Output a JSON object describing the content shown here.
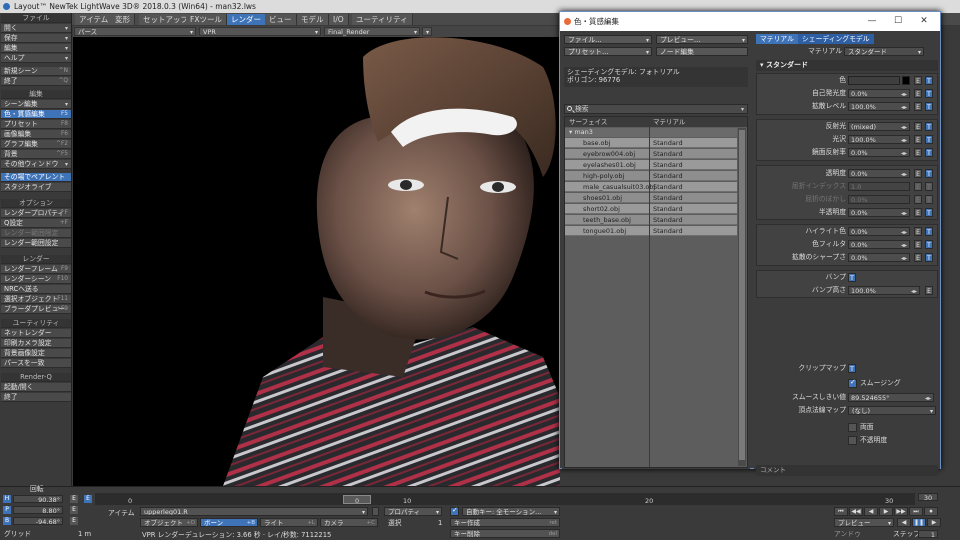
{
  "window": {
    "title": "Layout™ NewTek LightWave 3D® 2018.0.3 (Win64) - man32.lws"
  },
  "menu_tabs": [
    "アイテム",
    "変形",
    "セットアップ",
    "FXツール",
    "レンダー",
    "ビュー",
    "モデル",
    "I/O",
    "ユーティリティ"
  ],
  "active_tab": "レンダー",
  "sidebar": {
    "file_header": "ファイル",
    "file_items": [
      {
        "label": "開く",
        "dropdown": true
      },
      {
        "label": "保存",
        "dropdown": true
      },
      {
        "label": "編集",
        "dropdown": true
      },
      {
        "label": "ヘルプ",
        "dropdown": true
      }
    ],
    "new_scene": {
      "label": "新規シーン",
      "shortcut": "^N"
    },
    "quit": {
      "label": "終了",
      "shortcut": "^Q"
    },
    "edit_header": "編集",
    "edit_items": [
      {
        "label": "シーン編集",
        "shortcut": "",
        "dropdown": true
      },
      {
        "label": "色・質感編集",
        "shortcut": "F5",
        "active": true
      },
      {
        "label": "プリセット",
        "shortcut": "F8"
      },
      {
        "label": "画像編集",
        "shortcut": "F6"
      },
      {
        "label": "グラフ編集",
        "shortcut": "^F2"
      },
      {
        "label": "背景",
        "shortcut": "^F5"
      },
      {
        "label": "その他ウィンドウ",
        "dropdown": true
      },
      {
        "label": "その場でペアレント",
        "active": true
      },
      {
        "label": "スタジオライブ"
      }
    ],
    "option_header": "オプション",
    "option_items": [
      {
        "label": "レンダープロパティ",
        "shortcut": "^F"
      },
      {
        "label": "Q設定",
        "shortcut": "+F"
      },
      {
        "label": "レンダー範囲限定",
        "disabled": true
      },
      {
        "label": "レンダー範囲設定"
      }
    ],
    "render_header": "レンダー",
    "render_items": [
      {
        "label": "レンダーフレーム",
        "shortcut": "F9"
      },
      {
        "label": "レンダーシーン",
        "shortcut": "F10"
      },
      {
        "label": "NRCへ送る"
      },
      {
        "label": "選択オブジェクト",
        "shortcut": "F11"
      },
      {
        "label": "ブラーダプレビュー",
        "shortcut": "+F9"
      }
    ],
    "utility_header": "ユーティリティ",
    "utility_items": [
      {
        "label": "ネットレンダー"
      },
      {
        "label": "印刷カメラ設定"
      },
      {
        "label": "背景画像設定"
      },
      {
        "label": "パースを一致"
      }
    ],
    "renderq_header": "Render-Q",
    "renderq_items": [
      {
        "label": "起動/開く"
      },
      {
        "label": "終了"
      }
    ]
  },
  "viewport": {
    "view_mode": "パース",
    "render_mode": "VPR",
    "camera": "Final_Render"
  },
  "dialog": {
    "title": "色・質感編集",
    "buttons": {
      "file": "ファイル...",
      "preview": "プレビュー...",
      "preset": "プリセット...",
      "node_edit": "ノード編集"
    },
    "shading_model_line": "シェーディングモデル: フォトリアル",
    "polygon_line": "ポリゴン: 96776",
    "search_placeholder": "検索",
    "columns": {
      "surface": "サーフェイス",
      "material": "マテリアル"
    },
    "group": "man3",
    "surfaces": [
      {
        "name": "base.obj",
        "material": "Standard"
      },
      {
        "name": "eyebrow004.obj",
        "material": "Standard"
      },
      {
        "name": "eyelashes01.obj",
        "material": "Standard"
      },
      {
        "name": "high-poly.obj",
        "material": "Standard"
      },
      {
        "name": "male_casualsuit03.obj",
        "material": "Standard"
      },
      {
        "name": "shoes01.obj",
        "material": "Standard"
      },
      {
        "name": "short02.obj",
        "material": "Standard"
      },
      {
        "name": "teeth_base.obj",
        "material": "Standard"
      },
      {
        "name": "tongue01.obj",
        "material": "Standard"
      }
    ],
    "right_tabs": [
      "マテリアル",
      "シェーディングモデル"
    ],
    "material_label": "マテリアル",
    "material_value": "スタンダード",
    "section_standard": "スタンダード",
    "props": {
      "color": "色",
      "luminosity": {
        "label": "自己発光度",
        "value": "0.0%"
      },
      "diffuse": {
        "label": "拡散レベル",
        "value": "100.0%"
      },
      "reflection": {
        "label": "反射光",
        "value": "(mixed)"
      },
      "gloss": {
        "label": "光沢",
        "value": "100.0%"
      },
      "specular": {
        "label": "鏡面反射率",
        "value": "0.0%"
      },
      "transparency": {
        "label": "透明度",
        "value": "0.0%"
      },
      "refraction": {
        "label": "屈折インデックス",
        "value": "1.0"
      },
      "refraction_blur": {
        "label": "屈折のぼかし",
        "value": "0.0%"
      },
      "translucency": {
        "label": "半透明度",
        "value": "0.0%"
      },
      "highlight": {
        "label": "ハイライト色",
        "value": "0.0%"
      },
      "color_filter": {
        "label": "色フィルタ",
        "value": "0.0%"
      },
      "diffuse_sharpness": {
        "label": "拡散のシャープさ",
        "value": "0.0%"
      },
      "bump": {
        "label": "バンプ"
      },
      "bump_height": {
        "label": "バンプ高さ",
        "value": "100.0%"
      },
      "clip_map": {
        "label": "クリップマップ"
      },
      "smoothing": {
        "label": "スムージング",
        "checked": true
      },
      "smooth_threshold": {
        "label": "スムースしきい値",
        "value": "89.524655°"
      },
      "vertex_normal": {
        "label": "頂点法線マップ",
        "value": "(なし)"
      },
      "double_sided": {
        "label": "両面",
        "checked": false
      },
      "opaque": {
        "label": "不透明度",
        "checked": false
      }
    },
    "comment_label": "コメント"
  },
  "timeline": {
    "rotation_label": "回転",
    "h": {
      "label": "H",
      "value": "90.38°"
    },
    "p": {
      "label": "P",
      "value": "8.80°"
    },
    "b": {
      "label": "B",
      "value": "-94.68°"
    },
    "grid": {
      "label": "グリッド",
      "value": "1 m"
    },
    "ruler_ticks": [
      "0",
      "10",
      "20",
      "30"
    ],
    "current_frame": "0",
    "end_frame": "30",
    "item_label": "アイテム",
    "item_value": "upperleg01.R",
    "objects_btn": {
      "label": "オブジェクト",
      "shortcut": "+O"
    },
    "bones_btn": {
      "label": "ボーン",
      "shortcut": "+B"
    },
    "lights_btn": {
      "label": "ライト",
      "shortcut": "+L"
    },
    "cameras_btn": {
      "label": "カメラ",
      "shortcut": "+C"
    },
    "properties_btn": "プロパティ",
    "select_label": "選択",
    "select_value": "1",
    "auto_key": "自動キー: 全モーション...",
    "create_key": {
      "label": "キー作成",
      "shortcut": "ret"
    },
    "delete_key": {
      "label": "キー削除",
      "shortcut": "del"
    },
    "vpr_status": "VPR レンダーデュレーション: 3.66 秒 · レイ/秒数: 7112215",
    "preview_btn": "プレビュー",
    "step_label": "ステップ",
    "step_value": "1",
    "playback_label": "アンドゥ"
  },
  "colors": {
    "accent": "#3f73b8",
    "panel": "#3c3c3c",
    "surface_row": "#9a9a9a"
  }
}
